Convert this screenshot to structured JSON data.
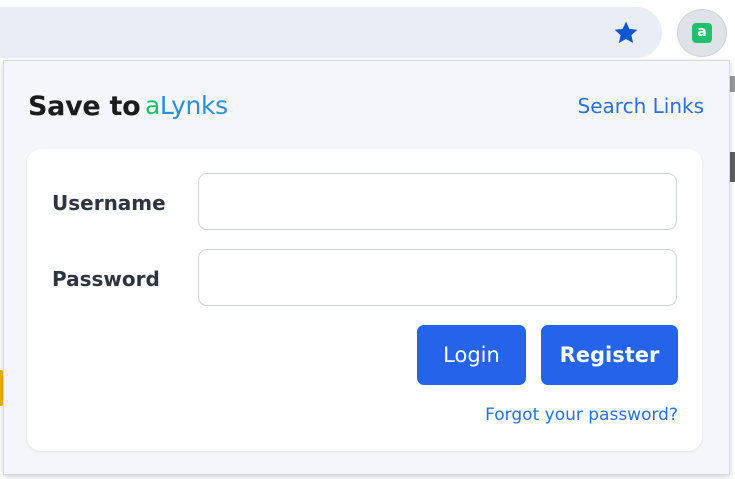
{
  "browser": {
    "bookmark_icon": "star-icon",
    "extension_icon": "alynks-logo-icon",
    "extension_glyph": "a"
  },
  "popup": {
    "title": "Save to",
    "brand": {
      "first": "a",
      "rest": "Lynks",
      "colors": {
        "first": "#1fbf6d",
        "rest": "#2b8fd6"
      }
    },
    "search_link": "Search Links",
    "form": {
      "username_label": "Username",
      "username_value": "",
      "password_label": "Password",
      "password_value": "",
      "login_label": "Login",
      "register_label": "Register",
      "forgot_link": "Forgot your password?"
    }
  },
  "colors": {
    "accent": "#2563eb",
    "link": "#2b6fd9",
    "panel_bg": "#f4f6f9",
    "card_bg": "#ffffff"
  }
}
